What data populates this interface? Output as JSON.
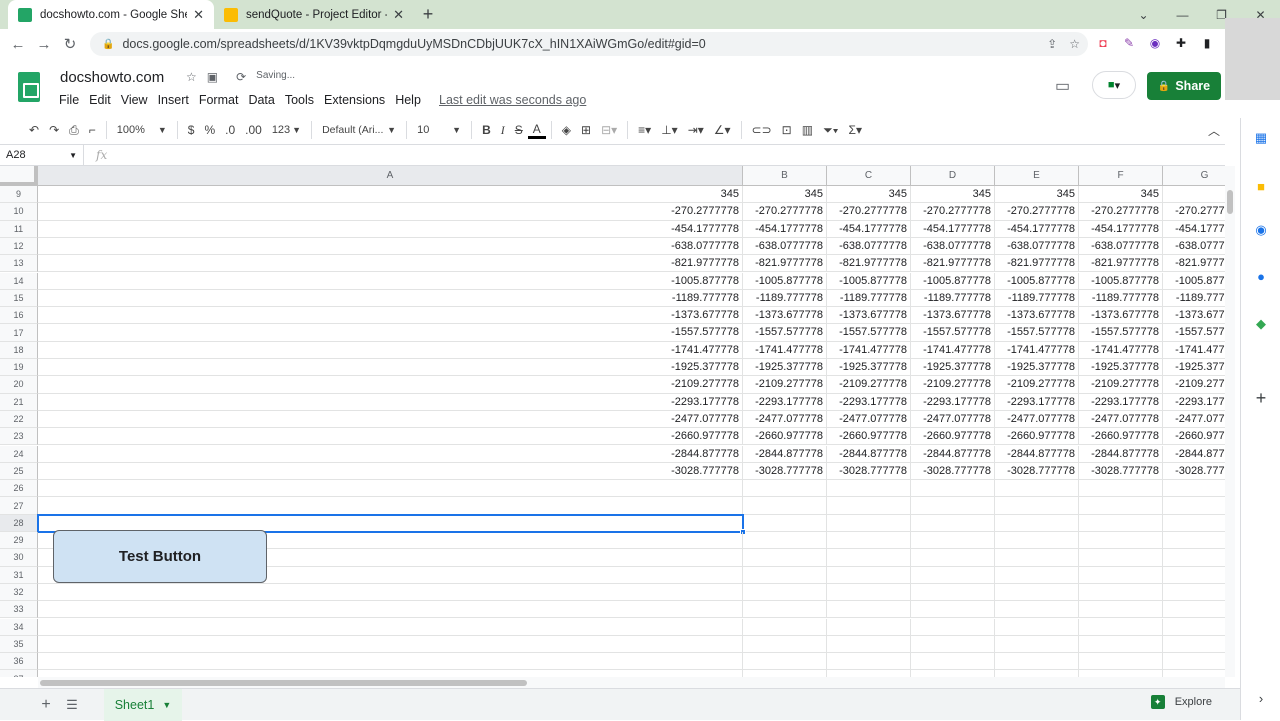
{
  "browser": {
    "tabs": [
      {
        "title": "docshowto.com - Google Sheets",
        "active": true,
        "favicon_color": "#23a566"
      },
      {
        "title": "sendQuote - Project Editor - App",
        "active": false,
        "favicon_color": "#fbbc04"
      }
    ],
    "url": "docs.google.com/spreadsheets/d/1KV39vktpDqmgduUyMSDnCDbjUUK7cX_hIN1XAiWGmGo/edit#gid=0"
  },
  "header": {
    "doc_title": "docshowto.com",
    "saving_status": "Saving...",
    "menus": [
      "File",
      "Edit",
      "View",
      "Insert",
      "Format",
      "Data",
      "Tools",
      "Extensions",
      "Help"
    ],
    "last_edit": "Last edit was seconds ago",
    "share_label": "Share"
  },
  "toolbar": {
    "zoom": "100%",
    "currency": "$",
    "percent": "%",
    "decrease_decimal": ".0",
    "increase_decimal": ".00",
    "more_formats": "123",
    "font": "Default (Ari...",
    "font_size": "10",
    "bold": "B",
    "italic": "I",
    "strike": "S",
    "text_color": "A"
  },
  "formula_bar": {
    "cell_ref": "A28",
    "fx": "fx",
    "value": ""
  },
  "grid": {
    "columns": [
      "A",
      "B",
      "C",
      "D",
      "E",
      "F",
      "G"
    ],
    "rows": [
      {
        "n": "9",
        "v": "345"
      },
      {
        "n": "10",
        "v": "-270.2777778"
      },
      {
        "n": "11",
        "v": "-454.1777778"
      },
      {
        "n": "12",
        "v": "-638.0777778"
      },
      {
        "n": "13",
        "v": "-821.9777778"
      },
      {
        "n": "14",
        "v": "-1005.877778"
      },
      {
        "n": "15",
        "v": "-1189.777778"
      },
      {
        "n": "16",
        "v": "-1373.677778"
      },
      {
        "n": "17",
        "v": "-1557.577778"
      },
      {
        "n": "18",
        "v": "-1741.477778"
      },
      {
        "n": "19",
        "v": "-1925.377778"
      },
      {
        "n": "20",
        "v": "-2109.277778"
      },
      {
        "n": "21",
        "v": "-2293.177778"
      },
      {
        "n": "22",
        "v": "-2477.077778"
      },
      {
        "n": "23",
        "v": "-2660.977778"
      },
      {
        "n": "24",
        "v": "-2844.877778"
      },
      {
        "n": "25",
        "v": "-3028.777778"
      },
      {
        "n": "26",
        "v": ""
      },
      {
        "n": "27",
        "v": ""
      },
      {
        "n": "28",
        "v": ""
      },
      {
        "n": "29",
        "v": ""
      },
      {
        "n": "30",
        "v": ""
      },
      {
        "n": "31",
        "v": ""
      },
      {
        "n": "32",
        "v": ""
      },
      {
        "n": "33",
        "v": ""
      },
      {
        "n": "34",
        "v": ""
      },
      {
        "n": "35",
        "v": ""
      },
      {
        "n": "36",
        "v": ""
      },
      {
        "n": "37",
        "v": ""
      }
    ],
    "selected_row": "28",
    "selected_col": "A"
  },
  "drawing": {
    "label": "Test Button"
  },
  "footer": {
    "sheet_name": "Sheet1",
    "explore_label": "Explore"
  },
  "colors": {
    "brand_green": "#188038",
    "selection_blue": "#1a73e8",
    "button_fill": "#cfe2f3"
  }
}
